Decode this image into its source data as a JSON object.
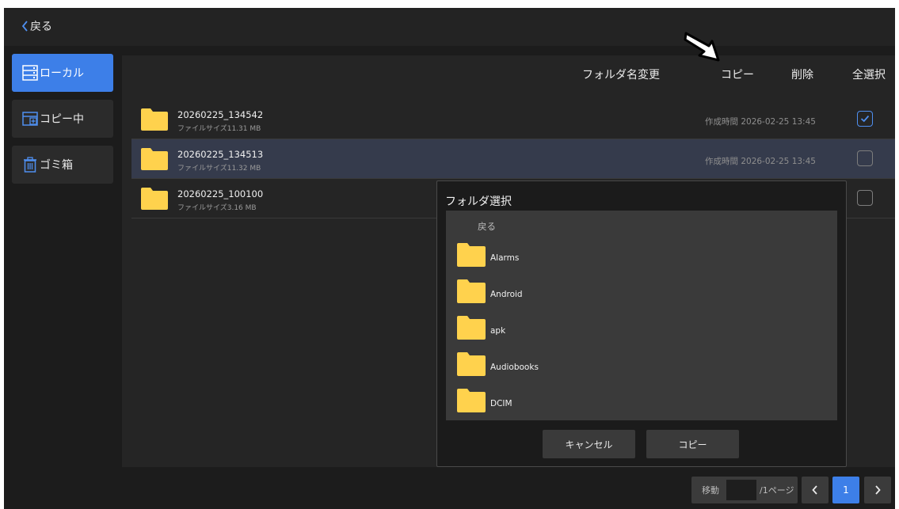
{
  "topbar": {
    "back_label": "戻る"
  },
  "sidebar": {
    "items": [
      {
        "label": "ローカル",
        "icon": "storage-icon"
      },
      {
        "label": "コピー中",
        "icon": "copying-icon"
      },
      {
        "label": "ゴミ箱",
        "icon": "trash-icon"
      }
    ]
  },
  "toolbar": {
    "rename_label": "フォルダ名変更",
    "copy_label": "コピー",
    "delete_label": "削除",
    "select_all_label": "全選択"
  },
  "files": [
    {
      "name": "20260225_134542",
      "size": "ファイルサイズ11.31 MB",
      "created": "作成時間 2026-02-25 13:45",
      "checked": true
    },
    {
      "name": "20260225_134513",
      "size": "ファイルサイズ11.32 MB",
      "created": "作成時間 2026-02-25 13:45",
      "checked": false
    },
    {
      "name": "20260225_100100",
      "size": "ファイルサイズ3.16 MB",
      "created": "",
      "checked": false
    }
  ],
  "dialog": {
    "title": "フォルダ選択",
    "back_label": "戻る",
    "folders": [
      "Alarms",
      "Android",
      "apk",
      "Audiobooks",
      "DCIM"
    ],
    "cancel_label": "キャンセル",
    "copy_label": "コピー"
  },
  "pagination": {
    "goto_label": "移動",
    "page_input_value": "",
    "total_label": "/1ページ",
    "current_page": "1"
  },
  "colors": {
    "accent": "#3d7fe8",
    "background": "#1c1c1c",
    "panel": "#252525",
    "selected_row": "#353b4c",
    "folder": "#ffd24d"
  }
}
